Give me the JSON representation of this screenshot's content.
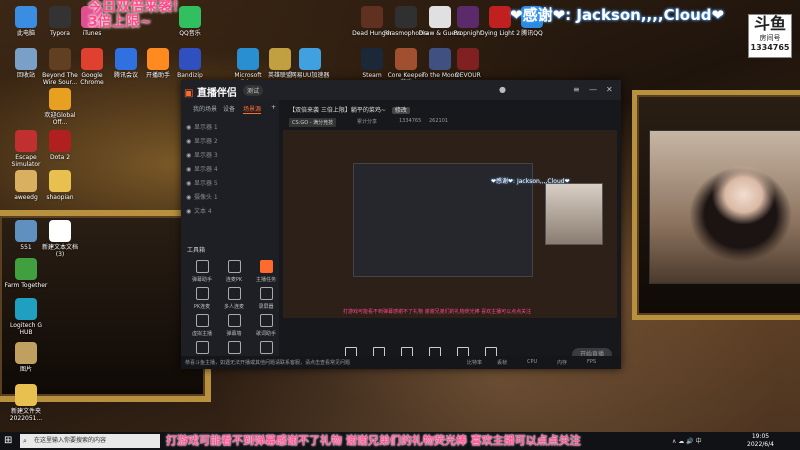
{
  "overlay": {
    "top_caption": "今日双倍来袭！\n3倍上限~",
    "thanks_text": "❤感谢❤: Jackson,,,,Cloud❤",
    "badge": {
      "line1": "斗鱼",
      "line2": "房间号",
      "room": "1334765"
    },
    "bottom_subtitle": "打游戏可能看不到弹幕感谢不了礼物 谢谢兄弟们的礼物荧光棒  喜欢主播可以点点关注"
  },
  "desktop_icons": [
    {
      "label": "此电脑",
      "color": "#3a8de0"
    },
    {
      "label": "回收站",
      "color": "#7aa0c8"
    },
    {
      "label": "Escape Simulator",
      "color": "#c03030"
    },
    {
      "label": "aweedg",
      "color": "#d8b060"
    },
    {
      "label": "551",
      "color": "#6090c0"
    },
    {
      "label": "Farm Together",
      "color": "#40a040"
    },
    {
      "label": "Logitech G HUB",
      "color": "#20a0c0"
    },
    {
      "label": "图片",
      "color": "#c0a060"
    },
    {
      "label": "新建文件夹 2022051...",
      "color": "#e8c050"
    },
    {
      "label": "Typora",
      "color": "#333333"
    },
    {
      "label": "iTunes",
      "color": "#e05090"
    },
    {
      "label": "Beyond The Wire Sour...",
      "color": "#604020"
    },
    {
      "label": "欢迎Global Off...",
      "color": "#e8a020"
    },
    {
      "label": "Dota 2",
      "color": "#b02020"
    },
    {
      "label": "shaopian",
      "color": "#e8c050"
    },
    {
      "label": "新建文本文档(3)",
      "color": "#ffffff"
    },
    {
      "label": "QQ音乐",
      "color": "#30c060"
    },
    {
      "label": "Google Chrome",
      "color": "#e04030"
    },
    {
      "label": "腾讯会议",
      "color": "#3070e0"
    },
    {
      "label": "开播助手",
      "color": "#ff8a20"
    },
    {
      "label": "Bandizip",
      "color": "#3050c0"
    },
    {
      "label": "Microsoft Edge",
      "color": "#2a8fd0"
    },
    {
      "label": "英雄联盟",
      "color": "#c0a040"
    },
    {
      "label": "Steam",
      "color": "#1b2838"
    },
    {
      "label": "网易UU加速器",
      "color": "#40a0e0"
    },
    {
      "label": "DEVOUR",
      "color": "#802020"
    },
    {
      "label": "Phasmophobia",
      "color": "#303030"
    },
    {
      "label": "Draw & Guess",
      "color": "#e0e0e0"
    },
    {
      "label": "Propnight",
      "color": "#5a2a6a"
    },
    {
      "label": "Dying Light 2",
      "color": "#c02020"
    },
    {
      "label": "腾讯QQ",
      "color": "#2a8ae0"
    },
    {
      "label": "To the Moon",
      "color": "#405080"
    },
    {
      "label": "Core Keeper 游戏",
      "color": "#a05030"
    },
    {
      "label": "Dead Hunger",
      "color": "#603020"
    }
  ],
  "app": {
    "logo": "直播伴侣",
    "version": "测试",
    "sidebar": {
      "tabs": [
        "我的场景",
        "设备",
        "场景源"
      ],
      "sources": [
        "显示器 1",
        "显示器 2",
        "显示器 3",
        "显示器 4",
        "显示器 5",
        "摄像头 1",
        "文本 4"
      ],
      "tools_title": "工具箱",
      "tools": [
        "弹幕助手",
        "连麦PK",
        "主播任务",
        "PK连麦",
        "多人连麦",
        "录屏器",
        "虚拟主播",
        "弹幕墙",
        "歌词助手",
        "新品",
        "福利",
        "更多"
      ]
    },
    "main": {
      "room_title": "【双倍来袭 三倍上限】躺平的菜鸡~",
      "edit": "修改",
      "tag": "CS:GO - 满分竞技",
      "meta_items": [
        "累计分享",
        "1334765",
        "262101"
      ],
      "preview_caption": "打游戏可能看不到弹幕感谢不了礼物 谢谢兄弟们的礼物荧光棒  喜欢主播可以点点关注",
      "preview_thanks": "❤感谢❤: Jackson,,,,Cloud❤",
      "controls": [
        "直播屏幕",
        "摄像头",
        "手机投屏",
        "多媒体",
        "麦克风",
        "扬声器"
      ],
      "start_button": "开始直播"
    },
    "status": {
      "note": "恭喜斗鱼主播，如遇无法开播或其他问题请联系客服，请点击查看常见问题",
      "stats": [
        "比特率",
        "丢帧",
        "CPU",
        "内存",
        "FPS"
      ]
    }
  },
  "taskbar": {
    "search_placeholder": "在这里输入你要搜索的内容",
    "tray": "∧ ☁ 🔊 中",
    "time": "19:05",
    "date": "2022/6/4"
  }
}
